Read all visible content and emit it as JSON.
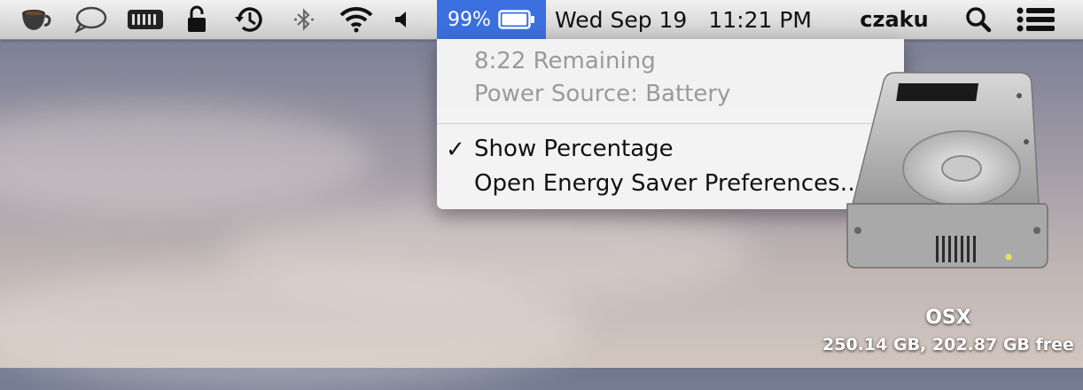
{
  "menubar": {
    "icons": [
      "coffee-cup-icon",
      "speech-bubble-icon",
      "battery-grid-icon",
      "padlock-icon",
      "time-machine-icon",
      "bluetooth-icon",
      "wifi-icon",
      "volume-icon",
      "spotlight-search-icon",
      "notification-list-icon"
    ],
    "battery_percentage": "99%",
    "battery_level": 0.99,
    "date": "Wed Sep 19",
    "time": "11:21 PM",
    "user": "czaku",
    "highlight_color": "#3b6fe0"
  },
  "battery_menu": {
    "remaining": "8:22 Remaining",
    "power_source": "Power Source: Battery",
    "show_percentage_label": "Show Percentage",
    "show_percentage_checked": true,
    "check_mark": "✓",
    "energy_saver_label": "Open Energy Saver Preferences…"
  },
  "desktop": {
    "volume_name": "OSX",
    "volume_info": "250.14 GB, 202.87 GB free"
  }
}
